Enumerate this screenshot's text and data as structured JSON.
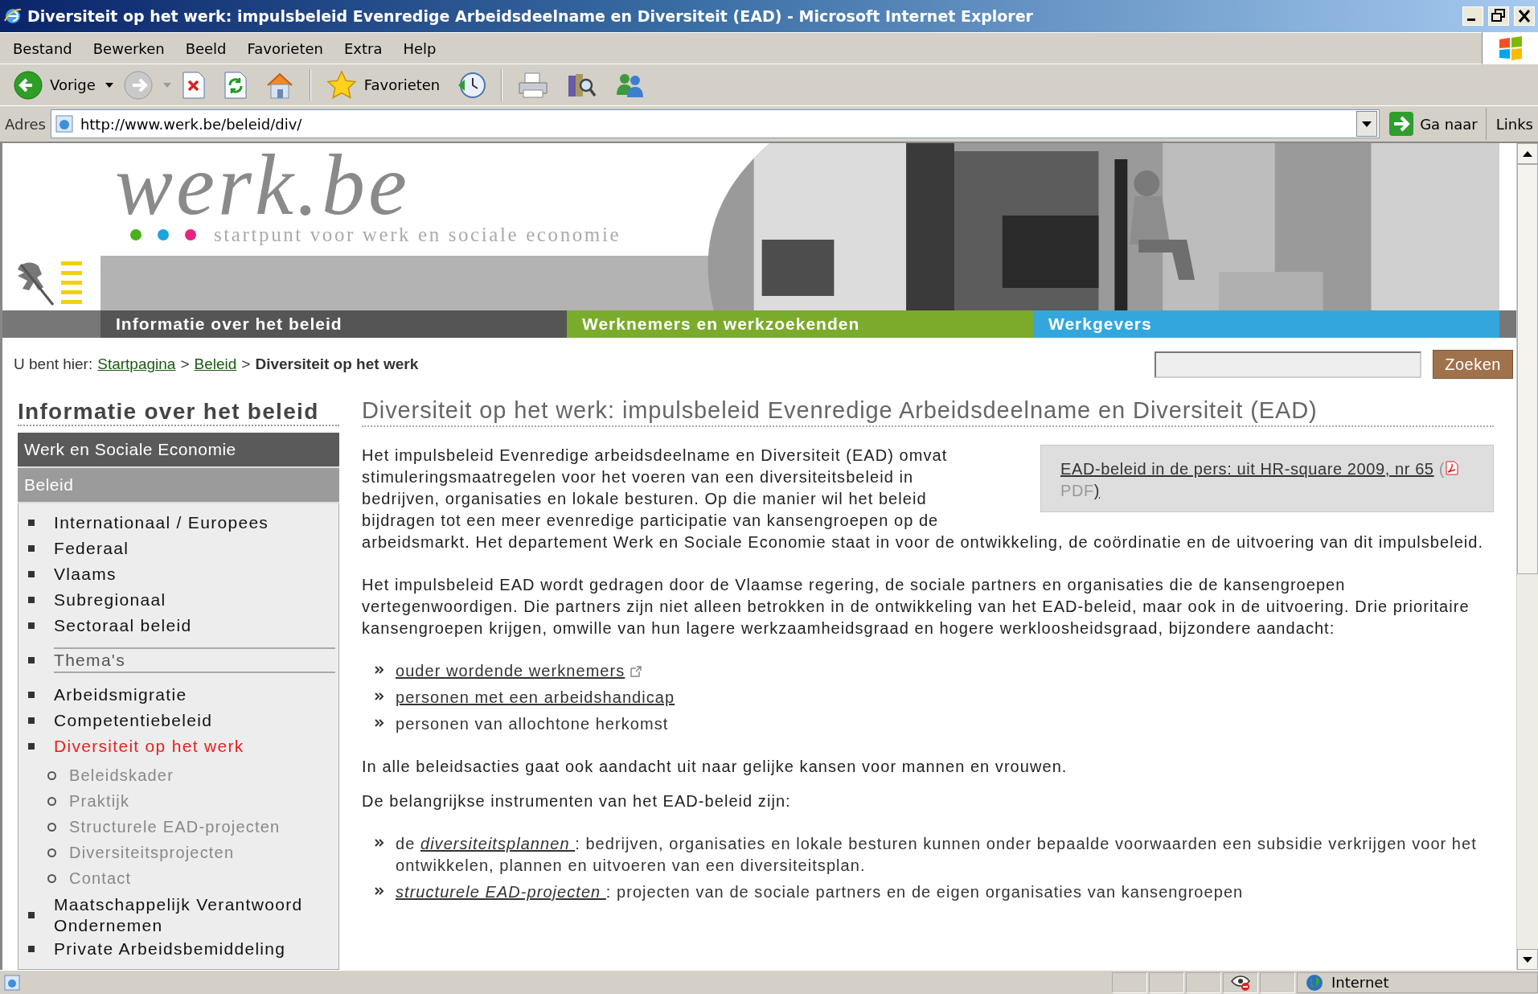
{
  "window": {
    "title": "Diversiteit op het werk: impulsbeleid Evenredige Arbeidsdeelname en Diversiteit (EAD) - Microsoft Internet Explorer"
  },
  "menu": [
    "Bestand",
    "Bewerken",
    "Beeld",
    "Favorieten",
    "Extra",
    "Help"
  ],
  "toolbar": {
    "groups": [
      [
        {
          "kind": "back",
          "label": "Vorige",
          "dropdown": true
        },
        {
          "kind": "forward",
          "dropdown": true,
          "disabled": true
        },
        {
          "kind": "stop"
        },
        {
          "kind": "refresh"
        },
        {
          "kind": "home"
        }
      ],
      [
        {
          "kind": "favorites",
          "label": "Favorieten"
        },
        {
          "kind": "history"
        }
      ],
      [
        {
          "kind": "print"
        },
        {
          "kind": "media"
        },
        {
          "kind": "messenger"
        }
      ]
    ]
  },
  "address": {
    "label": "Adres",
    "url": "http://www.werk.be/beleid/div/",
    "go": "Ga naar",
    "links": "Links"
  },
  "header": {
    "logo": "werk.be",
    "tagline": "startpunt voor werk en sociale economie"
  },
  "nav": [
    {
      "label": "Informatie over het beleid",
      "color": "#555555"
    },
    {
      "label": "Werknemers en werkzoekenden",
      "color": "#7aab2a"
    },
    {
      "label": "Werkgevers",
      "color": "#33a7dd"
    }
  ],
  "breadcrumb": {
    "label": "U bent hier:",
    "items": [
      {
        "kind": "link",
        "text": "Startpagina"
      },
      {
        "kind": "separator",
        "text": ">"
      },
      {
        "kind": "link",
        "text": "Beleid"
      },
      {
        "kind": "separator",
        "text": ">"
      },
      {
        "kind": "current",
        "text": "Diversiteit op het werk"
      }
    ]
  },
  "search": {
    "button": "Zoeken"
  },
  "sidebar": {
    "title": "Informatie over het beleid",
    "bars": [
      {
        "kind": "site",
        "label": "Werk en Sociale Economie"
      },
      {
        "kind": "section",
        "label": "Beleid"
      }
    ],
    "items": [
      {
        "kind": "link",
        "label": "Internationaal / Europees",
        "selected": false
      },
      {
        "kind": "link",
        "label": "Federaal",
        "selected": false
      },
      {
        "kind": "link",
        "label": "Vlaams",
        "selected": false
      },
      {
        "kind": "link",
        "label": "Subregionaal",
        "selected": false
      },
      {
        "kind": "link",
        "label": "Sectoraal beleid",
        "selected": false
      },
      {
        "kind": "heading",
        "label": "Thema's"
      },
      {
        "kind": "link",
        "label": "Arbeidsmigratie",
        "selected": false
      },
      {
        "kind": "link",
        "label": "Competentiebeleid",
        "selected": false
      },
      {
        "kind": "link",
        "label": "Diversiteit op het werk",
        "selected": true,
        "children": [
          {
            "label": "Beleidskader",
            "selected": false
          },
          {
            "label": "Praktijk",
            "selected": false
          },
          {
            "label": "Structurele EAD-projecten",
            "selected": false
          },
          {
            "label": "Diversiteitsprojecten",
            "selected": false
          },
          {
            "label": "Contact",
            "selected": false
          }
        ]
      },
      {
        "kind": "link",
        "label": "Maatschappelijk Verantwoord Ondernemen",
        "selected": false
      },
      {
        "kind": "link",
        "label": "Private Arbeidsbemiddeling",
        "selected": false
      }
    ]
  },
  "main": {
    "title": "Diversiteit op het werk: impulsbeleid Evenredige Arbeidsdeelname en Diversiteit (EAD)",
    "aside": {
      "link": "EAD-beleid in de pers: uit HR-square 2009, nr 65",
      "open": "(",
      "file": "PDF",
      "close": ")"
    },
    "blocks": [
      {
        "kind": "split",
        "parts": [
          "Het impulsbeleid Evenredige arbeidsdeelname en Diversiteit (EAD) omvat stimuleringsmaatregelen voor het voeren van een diversiteitsbeleid in bedrijven, organisaties en lokale besturen. Op die manier wil het beleid bijdragen tot een meer evenredige participatie van kansengroepen op de",
          "arbeidsmarkt.  Het departement Werk en Sociale Economie staat in voor de ontwikkeling, de coördinatie en de uitvoering van dit impulsbeleid."
        ]
      },
      {
        "kind": "paragraph",
        "text": "Het impulsbeleid EAD wordt gedragen door de Vlaamse regering, de sociale partners en organisaties die de kansengroepen vertegenwoordigen. Die partners zijn niet alleen betrokken in de ontwikkeling van het EAD-beleid, maar ook in de uitvoering. Drie prioritaire kansengroepen krijgen, omwille van hun lagere werkzaamheidsgraad en hogere werkloosheidsgraad, bijzondere aandacht:"
      },
      {
        "kind": "list",
        "items": [
          {
            "kind": "link",
            "text": "ouder wordende werknemers",
            "external": true
          },
          {
            "kind": "link",
            "text": "personen met een arbeidshandicap"
          },
          {
            "kind": "text",
            "text": "personen van allochtone herkomst"
          }
        ]
      },
      {
        "kind": "paragraph",
        "text": "In alle beleidsacties gaat ook aandacht uit naar gelijke kansen voor mannen en vrouwen."
      },
      {
        "kind": "paragraph",
        "text": "De belangrijkse instrumenten van het EAD-beleid zijn:"
      },
      {
        "kind": "list",
        "items": [
          {
            "kind": "term",
            "before": "de ",
            "link": "diversiteitsplannen ",
            "after": ": bedrijven, organisaties en lokale besturen kunnen onder bepaalde voorwaarden een subsidie verkrijgen voor het ontwikkelen, plannen en uitvoeren van een diversiteitsplan."
          },
          {
            "kind": "term",
            "link": "structurele EAD-projecten ",
            "after": ": projecten van de sociale partners en de eigen organisaties van kansengroepen"
          }
        ]
      }
    ]
  },
  "status": {
    "zone": "Internet"
  }
}
